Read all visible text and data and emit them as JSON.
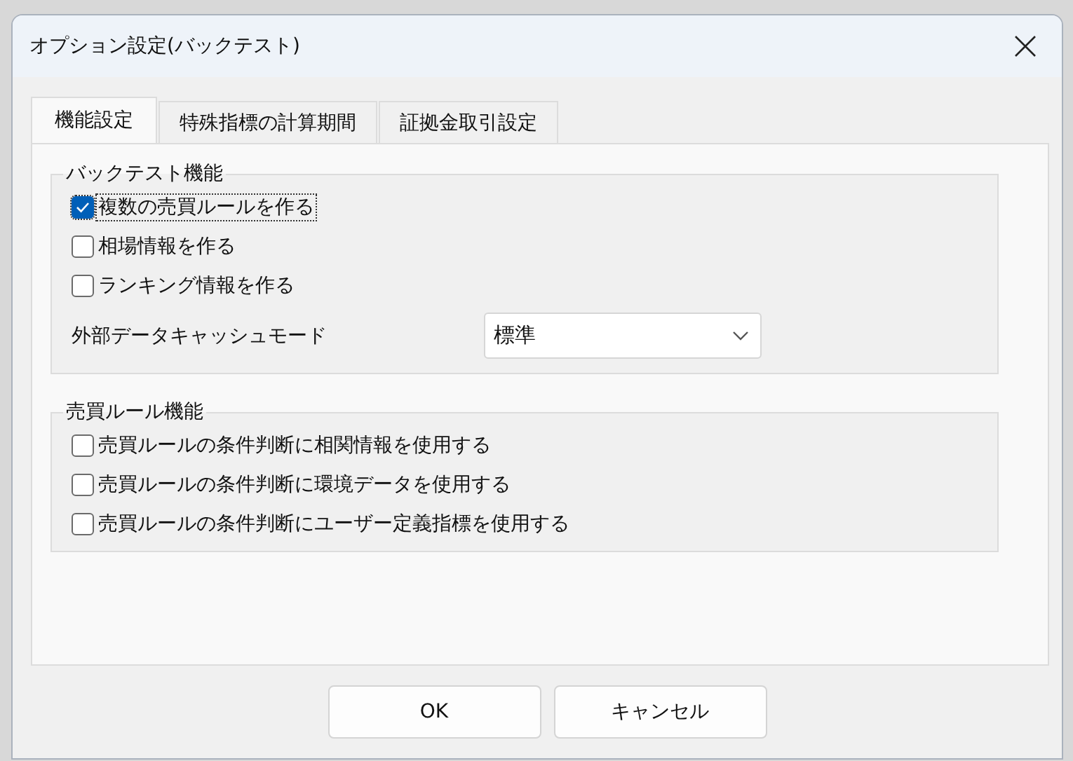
{
  "window": {
    "title": "オプション設定(バックテスト)"
  },
  "tabs": [
    {
      "label": "機能設定",
      "selected": true
    },
    {
      "label": "特殊指標の計算期間",
      "selected": false
    },
    {
      "label": "証拠金取引設定",
      "selected": false
    }
  ],
  "groups": [
    {
      "title": "バックテスト機能",
      "items": [
        {
          "kind": "checkbox",
          "label": "複数の売買ルールを作る",
          "checked": true,
          "focused": true
        },
        {
          "kind": "checkbox",
          "label": "相場情報を作る",
          "checked": false,
          "focused": false
        },
        {
          "kind": "checkbox",
          "label": "ランキング情報を作る",
          "checked": false,
          "focused": false
        },
        {
          "kind": "dropdown",
          "label": "外部データキャッシュモード",
          "value": "標準"
        }
      ]
    },
    {
      "title": "売買ルール機能",
      "items": [
        {
          "kind": "checkbox",
          "label": "売買ルールの条件判断に相関情報を使用する",
          "checked": false,
          "focused": false
        },
        {
          "kind": "checkbox",
          "label": "売買ルールの条件判断に環境データを使用する",
          "checked": false,
          "focused": false
        },
        {
          "kind": "checkbox",
          "label": "売買ルールの条件判断にユーザー定義指標を使用する",
          "checked": false,
          "focused": false
        }
      ]
    }
  ],
  "buttons": [
    "OK",
    "キャンセル"
  ]
}
